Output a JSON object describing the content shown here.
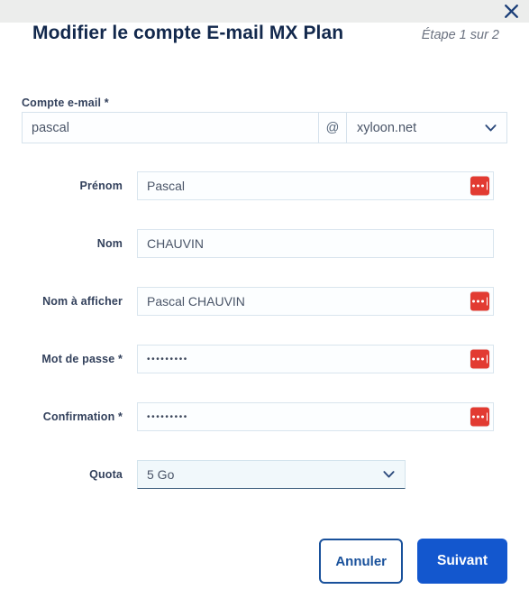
{
  "window": {
    "close_icon": "close-icon"
  },
  "header": {
    "title": "Modifier le compte E-mail MX Plan",
    "step": "Étape 1 sur 2"
  },
  "account": {
    "label": "Compte e-mail",
    "required_mark": "*",
    "local_part": "pascal",
    "at_symbol": "@",
    "domain_selected": "xyloon.net",
    "domain_options": [
      "xyloon.net"
    ],
    "local_placeholder": "",
    "chevron_icon": "chevron-down-icon"
  },
  "fields": [
    {
      "key": "firstname",
      "label": "Prénom",
      "required_mark": "",
      "value": "Pascal",
      "placeholder": "",
      "type": "text",
      "badge": true,
      "badge_icon": "autofill-badge-icon"
    },
    {
      "key": "lastname",
      "label": "Nom",
      "required_mark": "",
      "value": "CHAUVIN",
      "placeholder": "",
      "type": "text",
      "badge": false,
      "badge_icon": ""
    },
    {
      "key": "displayname",
      "label": "Nom à afficher",
      "required_mark": "",
      "value": "Pascal CHAUVIN",
      "placeholder": "",
      "type": "text",
      "badge": true,
      "badge_icon": "autofill-badge-icon"
    },
    {
      "key": "password",
      "label": "Mot de passe",
      "required_mark": "*",
      "value": "•••••••••",
      "placeholder": "",
      "type": "password",
      "badge": true,
      "badge_icon": "autofill-badge-icon"
    },
    {
      "key": "confirmation",
      "label": "Confirmation",
      "required_mark": "*",
      "value": "•••••••••",
      "placeholder": "",
      "type": "password",
      "badge": true,
      "badge_icon": "autofill-badge-icon"
    }
  ],
  "quota": {
    "label": "Quota",
    "selected": "5 Go",
    "options": [
      "5 Go"
    ],
    "chevron_icon": "chevron-down-icon"
  },
  "footer": {
    "cancel_label": "Annuler",
    "next_label": "Suivant"
  },
  "colors": {
    "primary_blue": "#1357CE",
    "outline_blue": "#19519B",
    "title_navy": "#12284C",
    "label_navy": "#33415C",
    "badge_red": "#E23B32",
    "topbar_gray": "#ECEDEC",
    "step_gray": "#6B7280"
  }
}
